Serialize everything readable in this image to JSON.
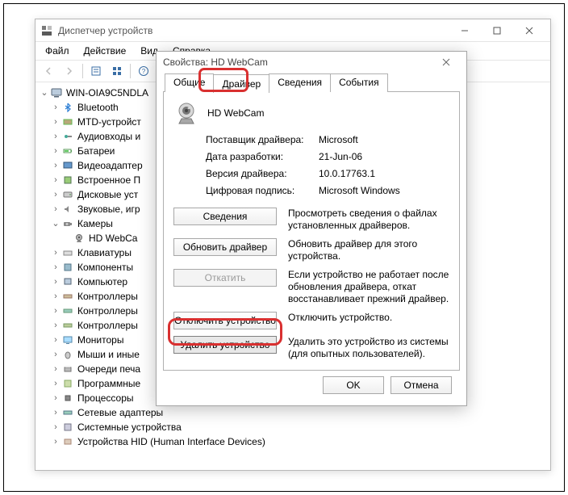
{
  "dm": {
    "title": "Диспетчер устройств",
    "menu": {
      "file": "Файл",
      "action": "Действие",
      "view": "Вид",
      "help": "Справка"
    },
    "root": "WIN-OIA9C5NDLA",
    "nodes": {
      "bluetooth": "Bluetooth",
      "mtd": "MTD-устройст",
      "audio": "Аудиовходы и",
      "battery": "Батареи",
      "video": "Видеоадаптер",
      "builtin": "Встроенное П",
      "disk": "Дисковые уст",
      "sound": "Звуковые, игр",
      "cameras": "Камеры",
      "webcam": "HD WebCa",
      "keyboard": "Клавиатуры",
      "component": "Компоненты",
      "computer": "Компьютер",
      "ctrl1": "Контроллеры",
      "ctrl2": "Контроллеры",
      "ctrl3": "Контроллеры",
      "monitor": "Мониторы",
      "mouse": "Мыши и иные",
      "printq": "Очереди печа",
      "software": "Программные",
      "cpu": "Процессоры",
      "netadapt": "Сетевые адаптеры",
      "sysdev": "Системные устройства",
      "hid": "Устройства HID (Human Interface Devices)"
    }
  },
  "prop": {
    "title": "Свойства: HD WebCam",
    "tabs": {
      "general": "Общие",
      "driver": "Драйвер",
      "details": "Сведения",
      "events": "События"
    },
    "device_name": "HD WebCam",
    "info": {
      "provider_k": "Поставщик драйвера:",
      "provider_v": "Microsoft",
      "date_k": "Дата разработки:",
      "date_v": "21-Jun-06",
      "version_k": "Версия драйвера:",
      "version_v": "10.0.17763.1",
      "sig_k": "Цифровая подпись:",
      "sig_v": "Microsoft Windows"
    },
    "buttons": {
      "details": "Сведения",
      "details_desc": "Просмотреть сведения о файлах установленных драйверов.",
      "update": "Обновить драйвер",
      "update_desc": "Обновить драйвер для этого устройства.",
      "rollback": "Откатить",
      "rollback_desc": "Если устройство не работает после обновления драйвера, откат восстанавливает прежний драйвер.",
      "disable": "Отключить устройство",
      "disable_desc": "Отключить устройство.",
      "remove": "Удалить устройство",
      "remove_desc": "Удалить это устройство из системы (для опытных пользователей)."
    },
    "footer": {
      "ok": "OK",
      "cancel": "Отмена"
    }
  }
}
